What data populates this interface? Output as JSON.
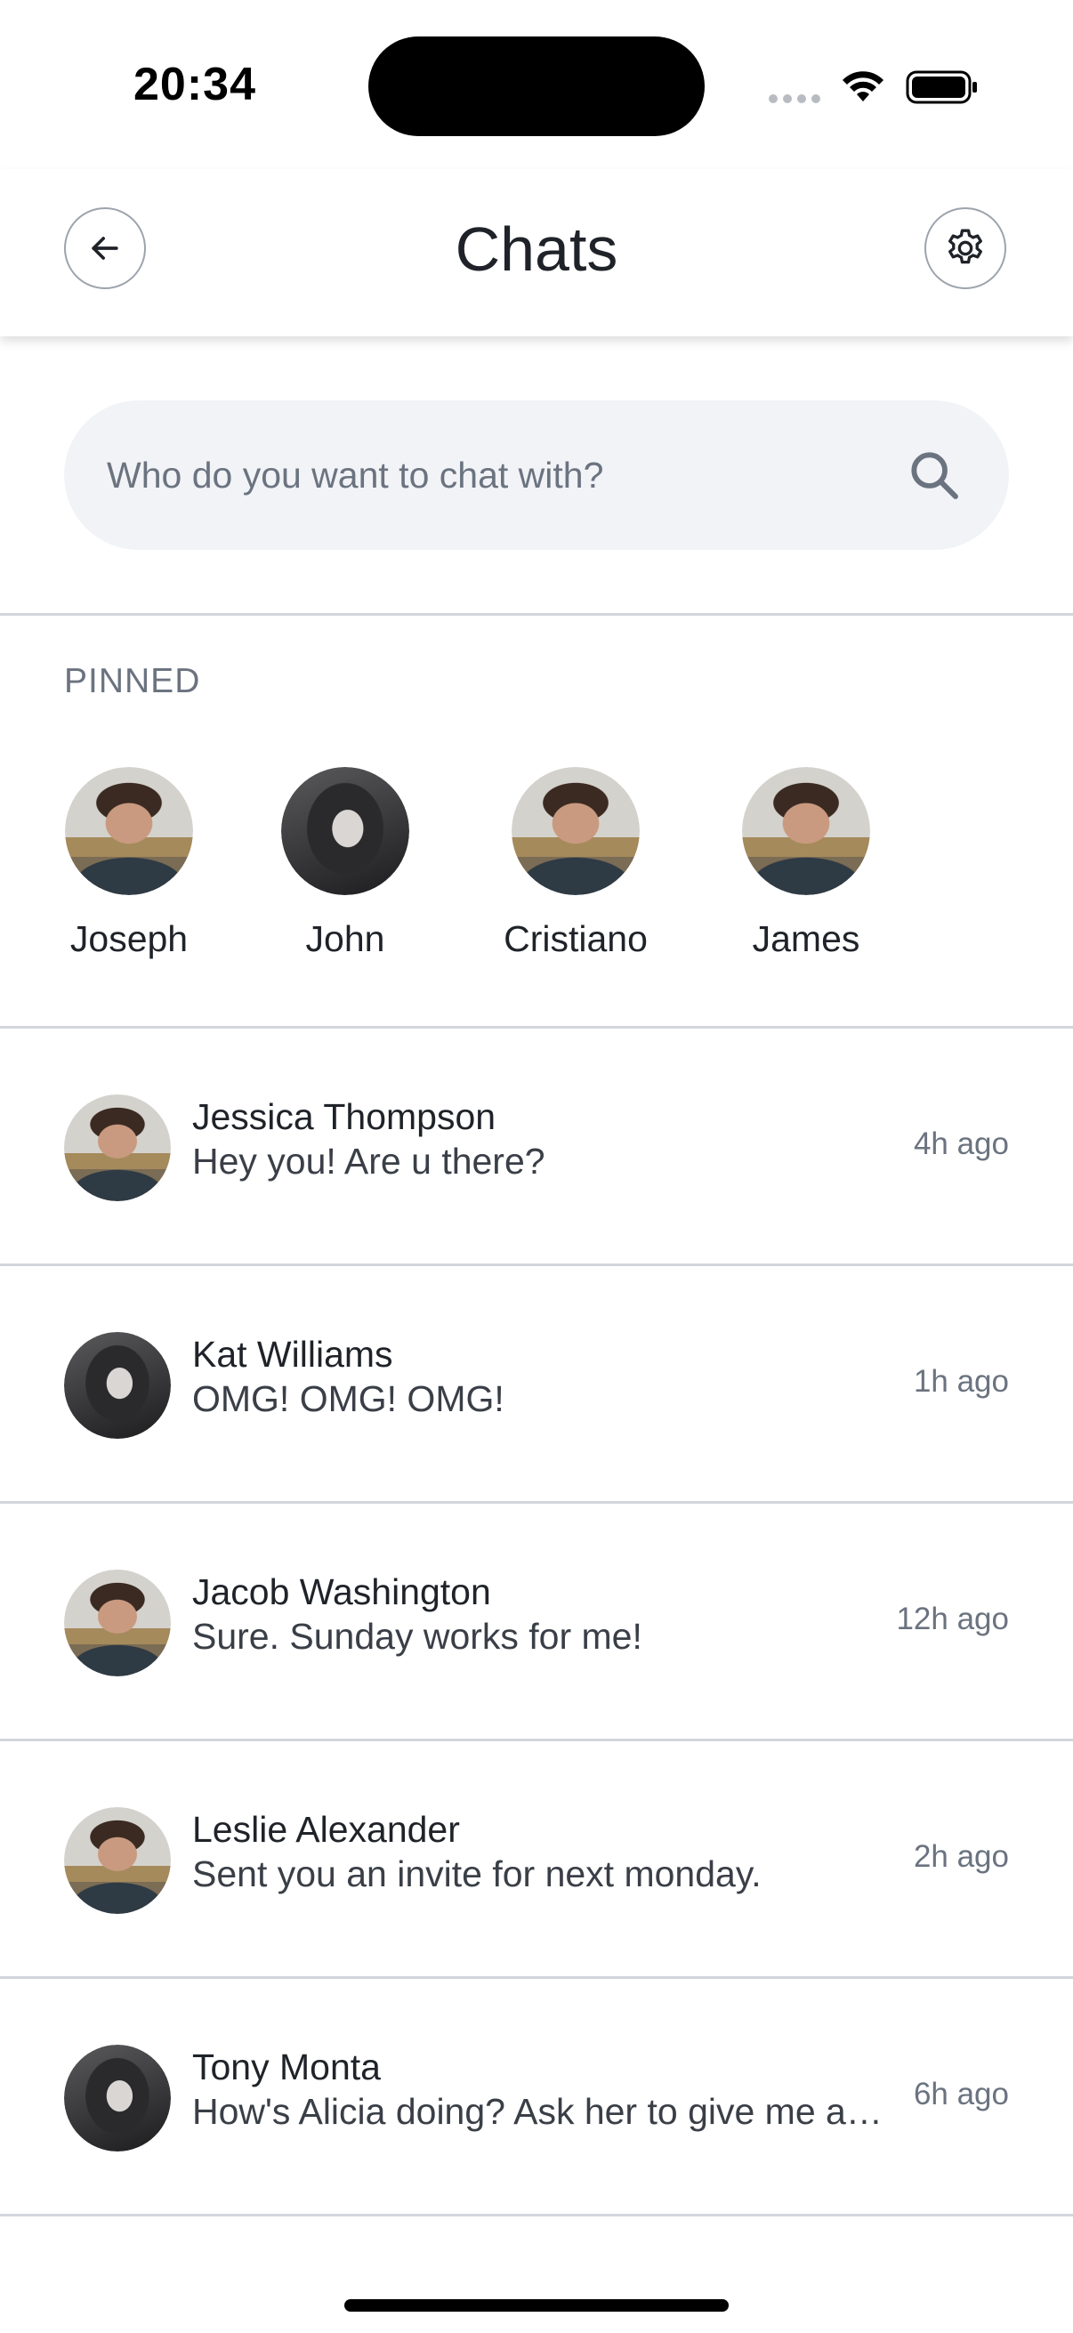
{
  "status_bar": {
    "time": "20:34"
  },
  "header": {
    "title": "Chats",
    "back_icon": "arrow-left-icon",
    "settings_icon": "gear-icon"
  },
  "search": {
    "placeholder": "Who do you want to chat with?",
    "value": "",
    "icon": "search-icon"
  },
  "pinned": {
    "label": "PINNED",
    "items": [
      {
        "name": "Joseph",
        "avatar": "man"
      },
      {
        "name": "John",
        "avatar": "woman"
      },
      {
        "name": "Cristiano",
        "avatar": "man"
      },
      {
        "name": "James",
        "avatar": "man"
      }
    ]
  },
  "chats": [
    {
      "name": "Jessica Thompson",
      "message": "Hey you! Are u there?",
      "time": "4h ago",
      "avatar": "man"
    },
    {
      "name": "Kat Williams",
      "message": "OMG! OMG! OMG!",
      "time": "1h ago",
      "avatar": "woman"
    },
    {
      "name": "Jacob Washington",
      "message": "Sure. Sunday works for me!",
      "time": "12h ago",
      "avatar": "man"
    },
    {
      "name": "Leslie Alexander",
      "message": "Sent you an invite for next monday.",
      "time": "2h ago",
      "avatar": "man"
    },
    {
      "name": "Tony Monta",
      "message": "How's Alicia doing? Ask her to give me a call.",
      "time": "6h ago",
      "avatar": "woman"
    }
  ],
  "colors": {
    "text_primary": "#1f2329",
    "text_secondary": "#6b7380",
    "search_bg": "#f1f3f6",
    "divider": "#d3d6dc"
  }
}
